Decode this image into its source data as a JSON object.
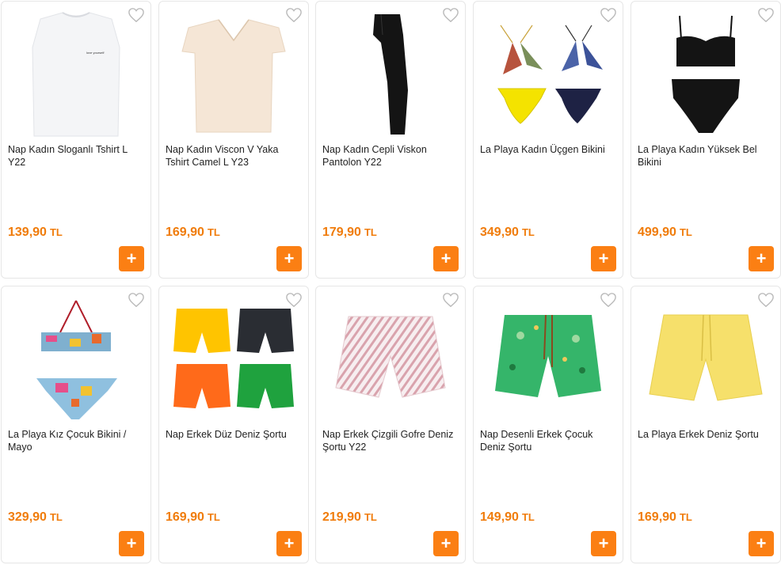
{
  "products": [
    {
      "name": "Nap Kadın Sloganlı Tshirt L Y22",
      "price": "139,90",
      "currency": "TL",
      "image_icon": "white-tshirt-icon"
    },
    {
      "name": "Nap Kadın Viscon V Yaka Tshirt Camel L Y23",
      "price": "169,90",
      "currency": "TL",
      "image_icon": "camel-vneck-tshirt-icon"
    },
    {
      "name": "Nap Kadın Cepli Viskon Pantolon Y22",
      "price": "179,90",
      "currency": "TL",
      "image_icon": "black-trousers-icon"
    },
    {
      "name": "La Playa Kadın Üçgen Bikini",
      "price": "349,90",
      "currency": "TL",
      "image_icon": "triangle-bikini-icon"
    },
    {
      "name": "La Playa Kadın Yüksek Bel Bikini",
      "price": "499,90",
      "currency": "TL",
      "image_icon": "high-waist-bikini-icon"
    },
    {
      "name": "La Playa Kız Çocuk Bikini / Mayo",
      "price": "329,90",
      "currency": "TL",
      "image_icon": "girls-bikini-icon"
    },
    {
      "name": "Nap Erkek Düz Deniz Şortu",
      "price": "169,90",
      "currency": "TL",
      "image_icon": "swim-shorts-set-icon"
    },
    {
      "name": "Nap Erkek Çizgili Gofre Deniz Şortu Y22",
      "price": "219,90",
      "currency": "TL",
      "image_icon": "striped-swim-shorts-icon"
    },
    {
      "name": "Nap Desenli Erkek Çocuk Deniz Şortu",
      "price": "149,90",
      "currency": "TL",
      "image_icon": "green-patterned-shorts-icon"
    },
    {
      "name": "La Playa Erkek Deniz Şortu",
      "price": "169,90",
      "currency": "TL",
      "image_icon": "yellow-swim-shorts-icon"
    }
  ],
  "add_button_symbol": "+",
  "tshirt_print_text": "love yourself",
  "colors": {
    "accent": "#fb7f13",
    "price": "#f07c0b"
  }
}
